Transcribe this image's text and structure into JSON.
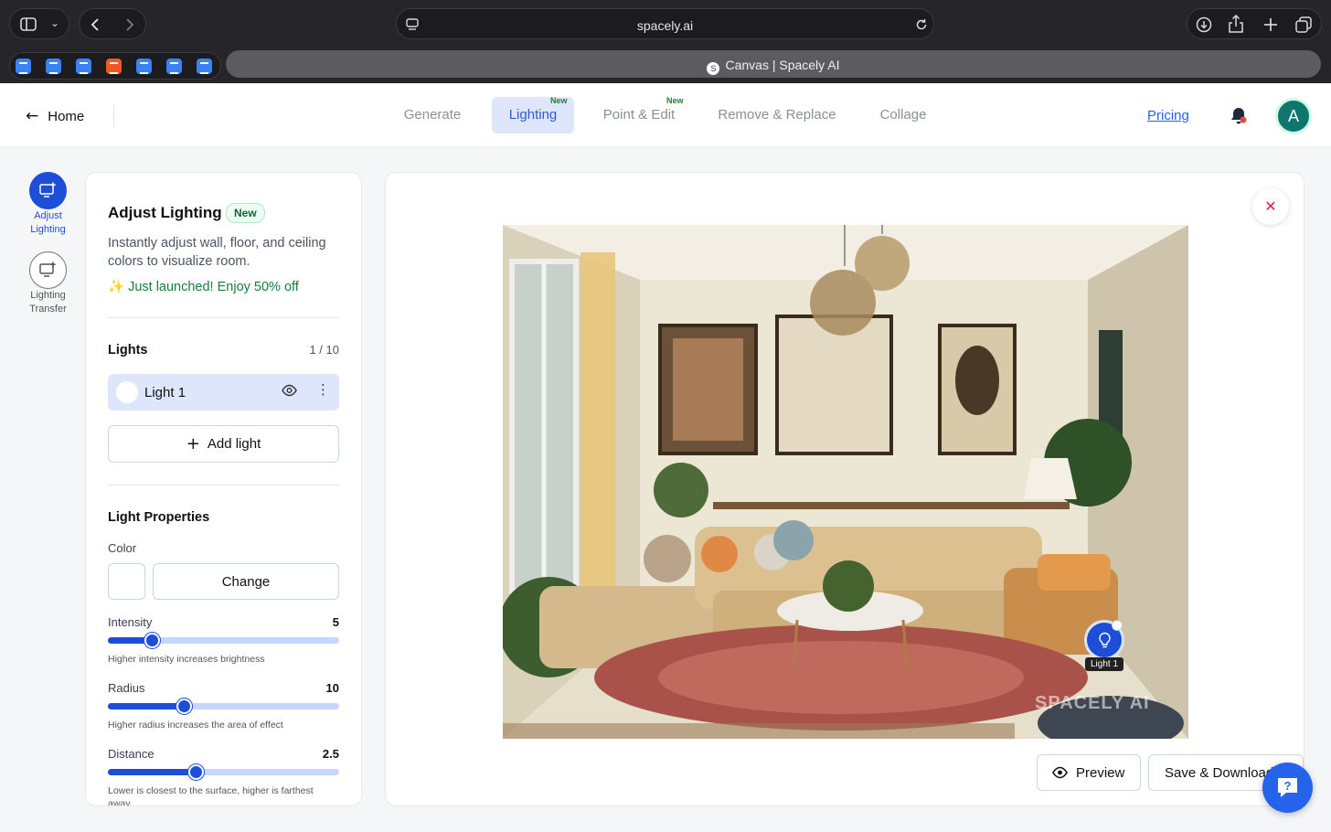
{
  "browser": {
    "url": "spacely.ai",
    "tab_title": "Canvas | Spacely AI"
  },
  "header": {
    "home_label": "Home",
    "nav": [
      {
        "label": "Generate",
        "badge": ""
      },
      {
        "label": "Lighting",
        "badge": "New"
      },
      {
        "label": "Point & Edit",
        "badge": "New"
      },
      {
        "label": "Remove & Replace",
        "badge": ""
      },
      {
        "label": "Collage",
        "badge": ""
      }
    ],
    "pricing_label": "Pricing",
    "avatar_initial": "A"
  },
  "rail": {
    "items": [
      {
        "label_line1": "Adjust",
        "label_line2": "Lighting"
      },
      {
        "label_line1": "Lighting",
        "label_line2": "Transfer"
      }
    ]
  },
  "panel": {
    "title": "Adjust Lighting",
    "title_badge": "New",
    "description": "Instantly adjust wall, floor, and ceiling colors to visualize room.",
    "promo": "✨ Just launched! Enjoy 50% off",
    "lights_heading": "Lights",
    "lights_count": "1 / 10",
    "lights": [
      {
        "name": "Light 1"
      }
    ],
    "add_light_label": "Add light",
    "properties_heading": "Light Properties",
    "color_label": "Color",
    "change_label": "Change",
    "sliders": {
      "intensity": {
        "label": "Intensity",
        "value": "5",
        "fraction": 0.19,
        "hint": "Higher intensity increases brightness"
      },
      "radius": {
        "label": "Radius",
        "value": "10",
        "fraction": 0.33,
        "hint": "Higher radius increases the area of effect"
      },
      "distance": {
        "label": "Distance",
        "value": "2.5",
        "fraction": 0.38,
        "hint": "Lower is closest to the surface, higher is farthest away"
      }
    }
  },
  "canvas": {
    "marker_label": "Light 1",
    "watermark": "SPACELY AI",
    "preview_label": "Preview",
    "save_label": "Save & Download"
  },
  "colors": {
    "accent": "#1d4ed8",
    "active_bg": "#dde6fb",
    "promo_green": "#15803d"
  }
}
